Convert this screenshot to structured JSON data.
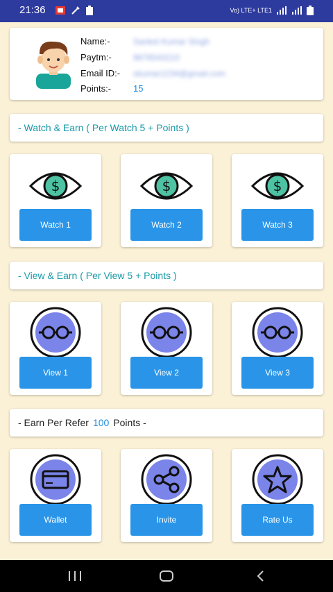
{
  "statusbar": {
    "time": "21:36",
    "network": "Vo) LTE+ LTE1"
  },
  "profile": {
    "name_label": "Name:-",
    "paytm_label": "Paytm:-",
    "email_label": "Email ID:-",
    "points_label": "Points:-",
    "name_value": "Sanket Kumar Singh",
    "paytm_value": "9876543210",
    "email_value": "skumar1234@gmail.com",
    "points_value": "15"
  },
  "watch_section": {
    "title": "- Watch & Earn ( Per Watch 5 + Points )",
    "buttons": [
      "Watch 1",
      "Watch 2",
      "Watch 3"
    ]
  },
  "view_section": {
    "title": "- View & Earn ( Per View 5 + Points )",
    "buttons": [
      "View 1",
      "View 2",
      "View 3"
    ]
  },
  "refer_section": {
    "prefix": "- Earn Per Refer",
    "points": "100",
    "suffix": "Points -",
    "buttons": [
      "Wallet",
      "Invite",
      "Rate Us"
    ]
  },
  "icons": {
    "watch": "eye-dollar-icon",
    "view": "glasses-icon",
    "wallet": "wallet-icon",
    "invite": "share-icon",
    "rate": "star-icon"
  },
  "colors": {
    "accent": "#2a95e8",
    "teal": "#1a9aa8",
    "circle": "#7b84e8",
    "background": "#fbf1d6",
    "statusbar": "#2d3a9e"
  }
}
